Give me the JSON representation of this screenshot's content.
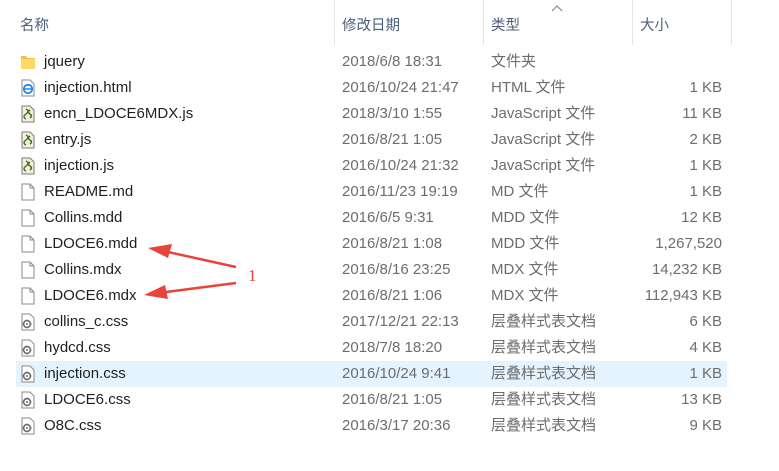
{
  "columns": {
    "name": "名称",
    "date": "修改日期",
    "type": "类型",
    "size": "大小"
  },
  "files": [
    {
      "name": "jquery",
      "date": "2018/6/8 18:31",
      "type": "文件夹",
      "size": "",
      "icon": "folder-icon"
    },
    {
      "name": "injection.html",
      "date": "2016/10/24 21:47",
      "type": "HTML 文件",
      "size": "1 KB",
      "icon": "html-file-icon"
    },
    {
      "name": "encn_LDOCE6MDX.js",
      "date": "2018/3/10 1:55",
      "type": "JavaScript 文件",
      "size": "11 KB",
      "icon": "js-file-icon"
    },
    {
      "name": "entry.js",
      "date": "2016/8/21 1:05",
      "type": "JavaScript 文件",
      "size": "2 KB",
      "icon": "js-file-icon"
    },
    {
      "name": "injection.js",
      "date": "2016/10/24 21:32",
      "type": "JavaScript 文件",
      "size": "1 KB",
      "icon": "js-file-icon"
    },
    {
      "name": "README.md",
      "date": "2016/11/23 19:19",
      "type": "MD 文件",
      "size": "1 KB",
      "icon": "file-icon"
    },
    {
      "name": "Collins.mdd",
      "date": "2016/6/5 9:31",
      "type": "MDD 文件",
      "size": "12 KB",
      "icon": "file-icon"
    },
    {
      "name": "LDOCE6.mdd",
      "date": "2016/8/21 1:08",
      "type": "MDD 文件",
      "size": "1,267,520",
      "icon": "file-icon"
    },
    {
      "name": "Collins.mdx",
      "date": "2016/8/16 23:25",
      "type": "MDX 文件",
      "size": "14,232 KB",
      "icon": "file-icon"
    },
    {
      "name": "LDOCE6.mdx",
      "date": "2016/8/21 1:06",
      "type": "MDX 文件",
      "size": "112,943 KB",
      "icon": "file-icon"
    },
    {
      "name": "collins_c.css",
      "date": "2017/12/21 22:13",
      "type": "层叠样式表文档",
      "size": "6 KB",
      "icon": "css-file-icon"
    },
    {
      "name": "hydcd.css",
      "date": "2018/7/8 18:20",
      "type": "层叠样式表文档",
      "size": "4 KB",
      "icon": "css-file-icon"
    },
    {
      "name": "injection.css",
      "date": "2016/10/24 9:41",
      "type": "层叠样式表文档",
      "size": "1 KB",
      "icon": "css-file-icon",
      "selected": true
    },
    {
      "name": "LDOCE6.css",
      "date": "2016/8/21 1:05",
      "type": "层叠样式表文档",
      "size": "13 KB",
      "icon": "css-file-icon"
    },
    {
      "name": "O8C.css",
      "date": "2016/3/17 20:36",
      "type": "层叠样式表文档",
      "size": "9 KB",
      "icon": "css-file-icon"
    }
  ],
  "annotation": {
    "label": "1",
    "color": "#e8443a"
  },
  "colors": {
    "selection": "#e5f3ff",
    "header_text": "#4c607a",
    "detail_text": "#6d6d6d"
  }
}
